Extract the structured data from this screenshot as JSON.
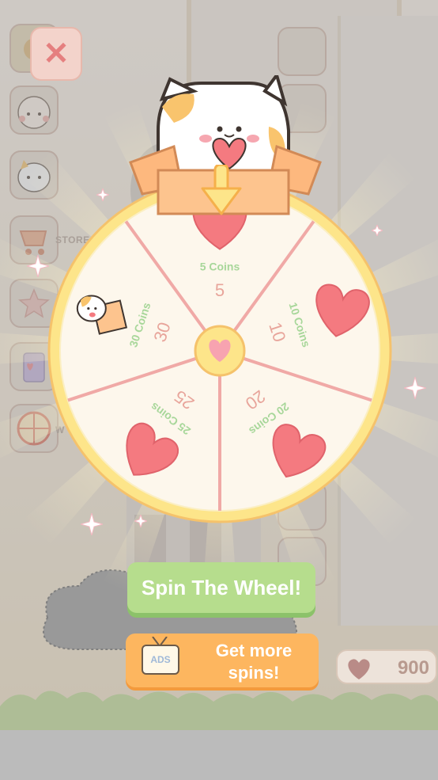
{
  "sidebar": {
    "items": [
      {
        "icon": "gear-icon",
        "label": ""
      },
      {
        "icon": "boy-face-icon",
        "label": ""
      },
      {
        "icon": "cat-face-icon",
        "label": ""
      },
      {
        "icon": "cart-icon",
        "label": "STORE"
      },
      {
        "icon": "star-icon",
        "label": ""
      },
      {
        "icon": "jar-icon",
        "label": ""
      },
      {
        "icon": "wheel-icon",
        "label": "W"
      }
    ]
  },
  "close_label": "✕",
  "wheel": {
    "segments": [
      {
        "coins_label": "5 Coins",
        "number": "5",
        "prize": "heart"
      },
      {
        "coins_label": "10 Coins",
        "number": "10",
        "prize": "heart"
      },
      {
        "coins_label": "20 Coins",
        "number": "20",
        "prize": "heart"
      },
      {
        "coins_label": "25 Coins",
        "number": "25",
        "prize": "heart"
      },
      {
        "coins_label": "30 Coins",
        "number": "30",
        "prize": "cat-in-box"
      }
    ]
  },
  "spin_button": {
    "label": "Spin The Wheel!"
  },
  "ads_button": {
    "icon_text": "ADS",
    "label_line1": "Get more",
    "label_line2": "spins!"
  },
  "hearts": {
    "count": "900"
  },
  "colors": {
    "wheel_rim": "#fde58a",
    "wheel_face": "#fdf7ec",
    "divider": "#f0a9a6",
    "heart": "#f47a80",
    "coins_text": "#a8d79a",
    "number_text": "#e8a59b",
    "spin_green": "#b6dd8d",
    "ads_orange": "#fdb65f"
  }
}
